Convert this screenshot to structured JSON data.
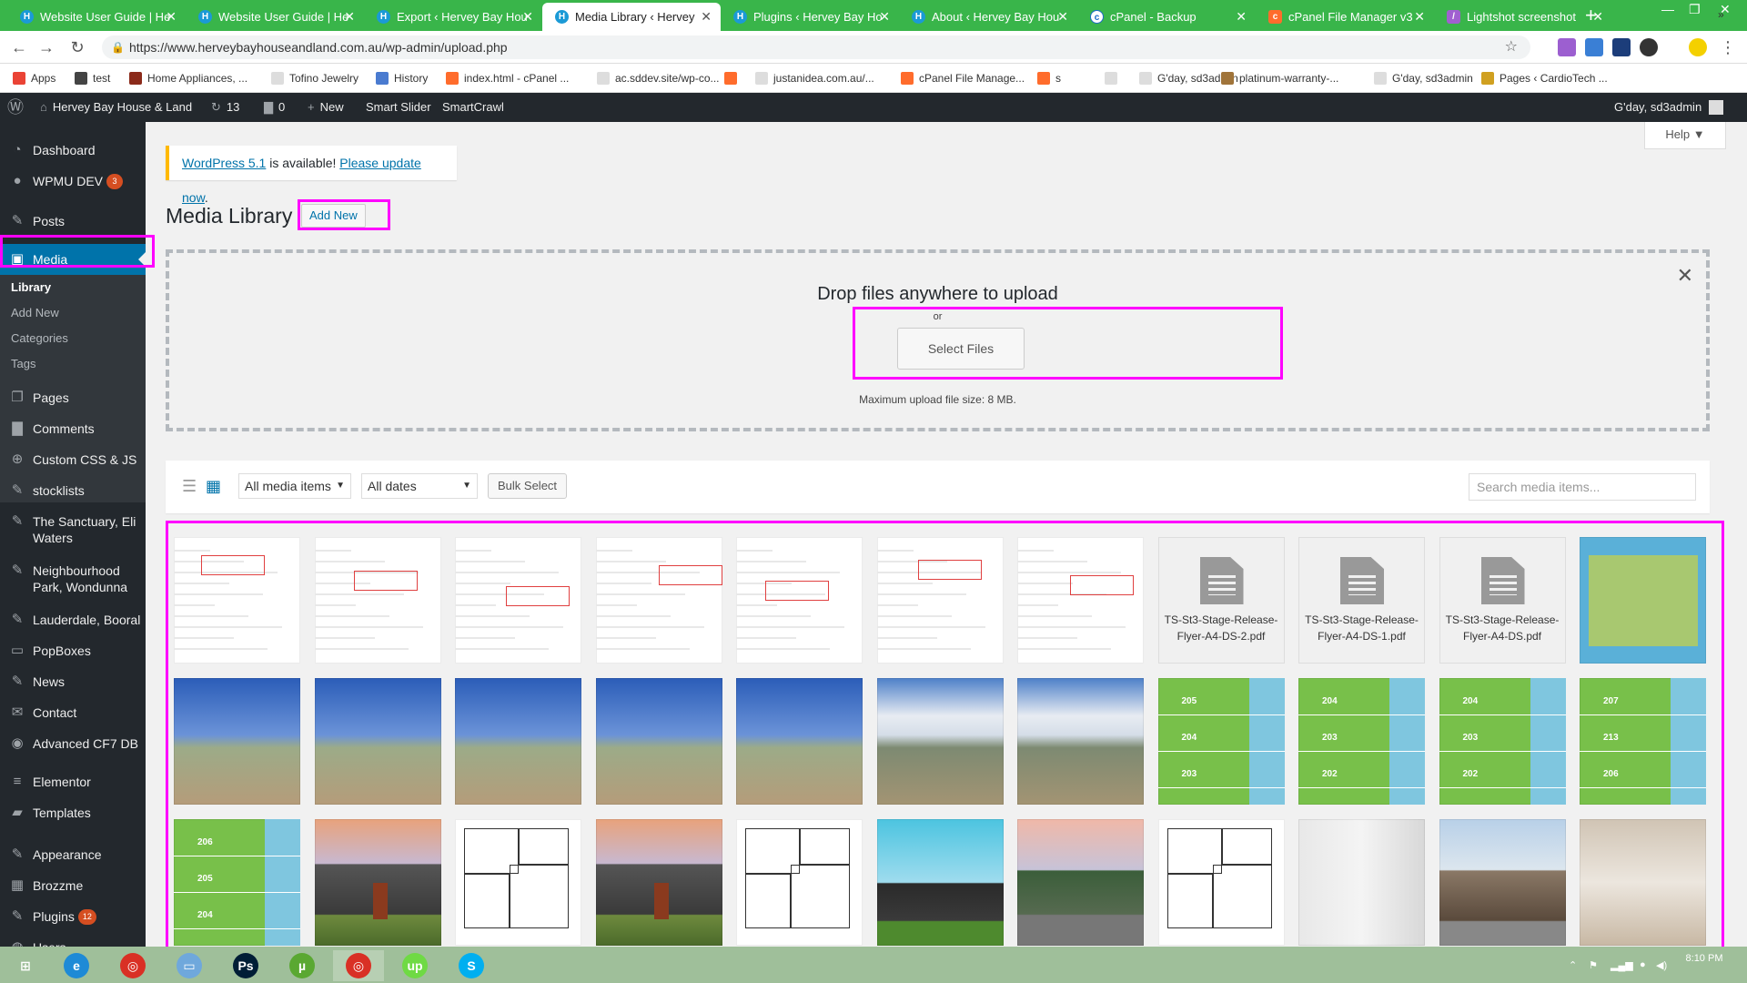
{
  "browser": {
    "tabs": [
      {
        "title": "Website User Guide | He",
        "fav": "H",
        "type": "wp"
      },
      {
        "title": "Website User Guide | He",
        "fav": "H",
        "type": "wp"
      },
      {
        "title": "Export ‹ Hervey Bay Hou",
        "fav": "H",
        "type": "wp"
      },
      {
        "title": "Media Library ‹ Hervey",
        "fav": "H",
        "type": "wp",
        "active": true
      },
      {
        "title": "Plugins ‹ Hervey Bay Ho",
        "fav": "H",
        "type": "wp"
      },
      {
        "title": "About ‹ Hervey Bay Hou",
        "fav": "H",
        "type": "wp"
      },
      {
        "title": "cPanel - Backup",
        "fav": "c",
        "type": "cpb"
      },
      {
        "title": "cPanel File Manager v3",
        "fav": "c",
        "type": "cp"
      },
      {
        "title": "Lightshot screenshot",
        "fav": "/",
        "type": "ls"
      }
    ],
    "new_tab": "+",
    "url": "https://www.herveybayhouseandland.com.au/wp-admin/upload.php",
    "bookmarks": [
      {
        "label": "Apps",
        "color": "#ea4335"
      },
      {
        "label": "test",
        "color": "#444444"
      },
      {
        "label": "Home Appliances, ...",
        "color": "#8b2a1a"
      },
      {
        "label": "Tofino Jewelry",
        "color": "#dddddd"
      },
      {
        "label": "History",
        "color": "#4a7bd0"
      },
      {
        "label": "index.html - cPanel ...",
        "color": "#ff6c2c"
      },
      {
        "label": "ac.sddev.site/wp-co...",
        "color": "#dddddd"
      },
      {
        "label": "",
        "color": "#ff6c2c"
      },
      {
        "label": "justanidea.com.au/...",
        "color": "#dddddd"
      },
      {
        "label": "cPanel File Manage...",
        "color": "#ff6c2c"
      },
      {
        "label": "s",
        "color": "#ff6c2c"
      },
      {
        "label": "",
        "color": "#dddddd"
      },
      {
        "label": "G'day, sd3admin",
        "color": "#dddddd"
      },
      {
        "label": "platinum-warranty-...",
        "color": "#a0743a"
      },
      {
        "label": "G'day, sd3admin",
        "color": "#dddddd"
      },
      {
        "label": "Pages ‹ CardioTech ...",
        "color": "#d0a020"
      }
    ],
    "more": "»"
  },
  "adminbar": {
    "site_name": "Hervey Bay House & Land",
    "updates": "13",
    "comments": "0",
    "new": "New",
    "smart_slider": "Smart Slider",
    "smartcrawl": "SmartCrawl",
    "greeting": "G'day, sd3admin"
  },
  "sidebar": {
    "items": [
      {
        "label": "Dashboard",
        "icon": "dashboard-icon",
        "glyph": "◔"
      },
      {
        "label": "WPMU DEV",
        "icon": "wpmudev-icon",
        "glyph": "●",
        "badge": "3"
      },
      {
        "label": "Posts",
        "icon": "pin-icon",
        "glyph": "✎"
      },
      {
        "label": "Media",
        "icon": "media-icon",
        "glyph": "▣",
        "current": true
      },
      {
        "label": "Pages",
        "icon": "pages-icon",
        "glyph": "❐"
      },
      {
        "label": "Comments",
        "icon": "comments-icon",
        "glyph": "▇"
      },
      {
        "label": "Custom CSS & JS",
        "icon": "plus-icon",
        "glyph": "⊕"
      },
      {
        "label": "stocklists",
        "icon": "pin-icon",
        "glyph": "✎"
      },
      {
        "label": "The Sanctuary, Eli Waters",
        "icon": "pin-icon",
        "glyph": "✎"
      },
      {
        "label": "Neighbourhood Park, Wondunna",
        "icon": "pin-icon",
        "glyph": "✎"
      },
      {
        "label": "Lauderdale, Booral",
        "icon": "pin-icon",
        "glyph": "✎"
      },
      {
        "label": "PopBoxes",
        "icon": "popbox-icon",
        "glyph": "▭"
      },
      {
        "label": "News",
        "icon": "news-icon",
        "glyph": "✎"
      },
      {
        "label": "Contact",
        "icon": "mail-icon",
        "glyph": "✉"
      },
      {
        "label": "Advanced CF7 DB",
        "icon": "eye-icon",
        "glyph": "◉"
      },
      {
        "label": "Elementor",
        "icon": "elementor-icon",
        "glyph": "≡"
      },
      {
        "label": "Templates",
        "icon": "folder-icon",
        "glyph": "▰"
      },
      {
        "label": "Appearance",
        "icon": "brush-icon",
        "glyph": "✎"
      },
      {
        "label": "Brozzme",
        "icon": "grid-icon",
        "glyph": "▦"
      },
      {
        "label": "Plugins",
        "icon": "plugin-icon",
        "glyph": "✎",
        "badge": "12"
      },
      {
        "label": "Users",
        "icon": "users-icon",
        "glyph": "◍"
      }
    ],
    "submenu": [
      "Library",
      "Add New",
      "Categories",
      "Tags"
    ]
  },
  "notice": {
    "link1": "WordPress 5.1",
    "text": " is available! ",
    "link2": "Please update now",
    "end": "."
  },
  "help": "Help ▼",
  "page_title": "Media Library",
  "add_new": "Add New",
  "upload": {
    "title": "Drop files anywhere to upload",
    "or": "or",
    "button": "Select Files",
    "max": "Maximum upload file size: 8 MB."
  },
  "toolbar": {
    "filter_type": "All media items",
    "filter_date": "All dates",
    "bulk": "Bulk Select",
    "search_placeholder": "Search media items..."
  },
  "media": [
    {
      "type": "shot"
    },
    {
      "type": "shot"
    },
    {
      "type": "shot"
    },
    {
      "type": "shot"
    },
    {
      "type": "shot"
    },
    {
      "type": "shot"
    },
    {
      "type": "shot"
    },
    {
      "type": "doc",
      "name": "TS-St3-Stage-Release-Flyer-A4-DS-2.pdf"
    },
    {
      "type": "doc",
      "name": "TS-St3-Stage-Release-Flyer-A4-DS-1.pdf"
    },
    {
      "type": "doc",
      "name": "TS-St3-Stage-Release-Flyer-A4-DS.pdf"
    },
    {
      "type": "aerial"
    },
    {
      "type": "sky"
    },
    {
      "type": "sky"
    },
    {
      "type": "sky"
    },
    {
      "type": "sky"
    },
    {
      "type": "sky"
    },
    {
      "type": "cloudy"
    },
    {
      "type": "cloudy"
    },
    {
      "type": "plot",
      "labels": [
        "205",
        "204",
        "203"
      ]
    },
    {
      "type": "plot",
      "labels": [
        "204",
        "203",
        "202"
      ]
    },
    {
      "type": "plot",
      "labels": [
        "204",
        "203",
        "202"
      ]
    },
    {
      "type": "plot",
      "labels": [
        "207",
        "213",
        "206"
      ]
    },
    {
      "type": "plot",
      "labels": [
        "206",
        "205",
        "204"
      ]
    },
    {
      "type": "house"
    },
    {
      "type": "plan"
    },
    {
      "type": "house"
    },
    {
      "type": "plan"
    },
    {
      "type": "modern"
    },
    {
      "type": "green-house"
    },
    {
      "type": "plan"
    },
    {
      "type": "bath"
    },
    {
      "type": "facade"
    },
    {
      "type": "kitchen"
    }
  ],
  "taskbar": {
    "apps": [
      {
        "name": "start",
        "glyph": "⊞",
        "color": "#ffffff"
      },
      {
        "name": "ie",
        "glyph": "e",
        "color": "#1e8ad6"
      },
      {
        "name": "chrome",
        "glyph": "◎",
        "color": "#d93025"
      },
      {
        "name": "explorer",
        "glyph": "▭",
        "color": "#6fa8dc"
      },
      {
        "name": "photoshop",
        "glyph": "Ps",
        "color": "#001e36"
      },
      {
        "name": "utorrent",
        "glyph": "µ",
        "color": "#5aa832"
      },
      {
        "name": "chrome-2",
        "glyph": "◎",
        "color": "#d93025"
      },
      {
        "name": "upwork",
        "glyph": "up",
        "color": "#6fda44"
      },
      {
        "name": "skype",
        "glyph": "S",
        "color": "#00aff0"
      }
    ],
    "time": "8:10 PM"
  }
}
